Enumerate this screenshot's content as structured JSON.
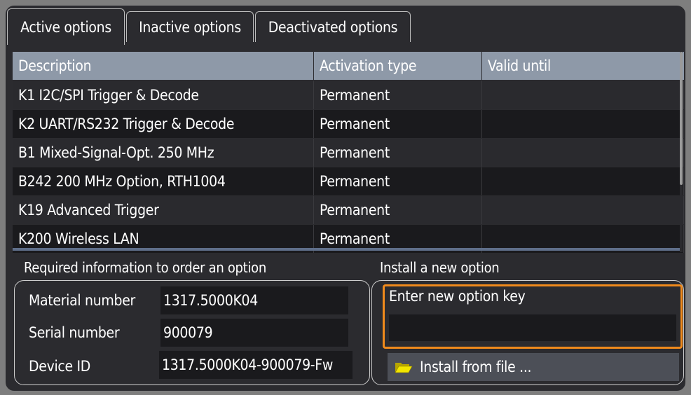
{
  "tabs": [
    {
      "label": "Active options",
      "active": true
    },
    {
      "label": "Inactive options",
      "active": false
    },
    {
      "label": "Deactivated options",
      "active": false
    }
  ],
  "table": {
    "headers": [
      "Description",
      "Activation type",
      "Valid until"
    ],
    "rows": [
      [
        "K1 I2C/SPI Trigger & Decode",
        "Permanent",
        ""
      ],
      [
        "K2 UART/RS232 Trigger & Decode",
        "Permanent",
        ""
      ],
      [
        "B1 Mixed-Signal-Opt. 250 MHz",
        "Permanent",
        ""
      ],
      [
        "B242 200 MHz Option, RTH1004",
        "Permanent",
        ""
      ],
      [
        "K19 Advanced Trigger",
        "Permanent",
        ""
      ],
      [
        "K200 Wireless LAN",
        "Permanent",
        ""
      ]
    ]
  },
  "order_info": {
    "title": "Required information to order an option",
    "material_label": "Material number",
    "material_value": "1317.5000K04",
    "serial_label": "Serial number",
    "serial_value": "900079",
    "device_label": "Device ID",
    "device_value": "1317.5000K04-900079-Fw"
  },
  "install": {
    "title": "Install a new option",
    "key_label": "Enter new option key",
    "key_value": "",
    "file_button": "Install from file ...",
    "folder_icon": "folder-open-icon"
  },
  "colors": {
    "accent": "#f08a1c",
    "header_bg": "#8e99a8",
    "panel_bg": "#2b2b2f"
  }
}
